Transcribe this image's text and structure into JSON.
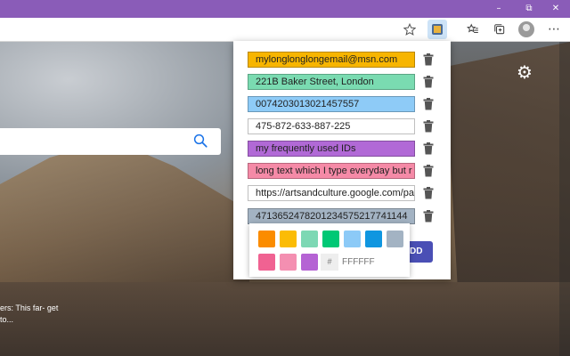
{
  "window": {
    "minimize_glyph": "–",
    "maximize_glyph": "⧉",
    "close_glyph": "✕"
  },
  "toolbar": {
    "icons": [
      "star-icon",
      "extension-icon",
      "favorites-icon",
      "collections-icon",
      "profile-avatar",
      "more-icon"
    ],
    "more_glyph": "⋯"
  },
  "newtab": {
    "caption_text": "ers: This far- get to..."
  },
  "popup": {
    "items": [
      {
        "text": "mylonglonglongemail@msn.com",
        "color": "#f7b500"
      },
      {
        "text": "221B Baker Street, London",
        "color": "#7adbb1"
      },
      {
        "text": "0074203013021457557",
        "color": "#8ecbf7"
      },
      {
        "text": "475-872-633-887-225",
        "color": "#ffffff"
      },
      {
        "text": "my frequently used IDs",
        "color": "#b169d6"
      },
      {
        "text": "long text which I type everyday but r",
        "color": "#f58aa7"
      },
      {
        "text": "https://artsandculture.google.com/pa",
        "color": "#ffffff"
      },
      {
        "text": "4713652478201234575217741144",
        "color": "#a3b3c3"
      }
    ],
    "add_label": "DD",
    "palette": {
      "colors": [
        "#fb8c00",
        "#fbbc05",
        "#7dd8b4",
        "#00c875",
        "#8ccaf7",
        "#0f96e0",
        "#a3b3c3",
        "#f06292",
        "#f48fb1",
        "#b563d4"
      ],
      "hash_label": "#",
      "hex_placeholder": "FFFFFF"
    }
  }
}
